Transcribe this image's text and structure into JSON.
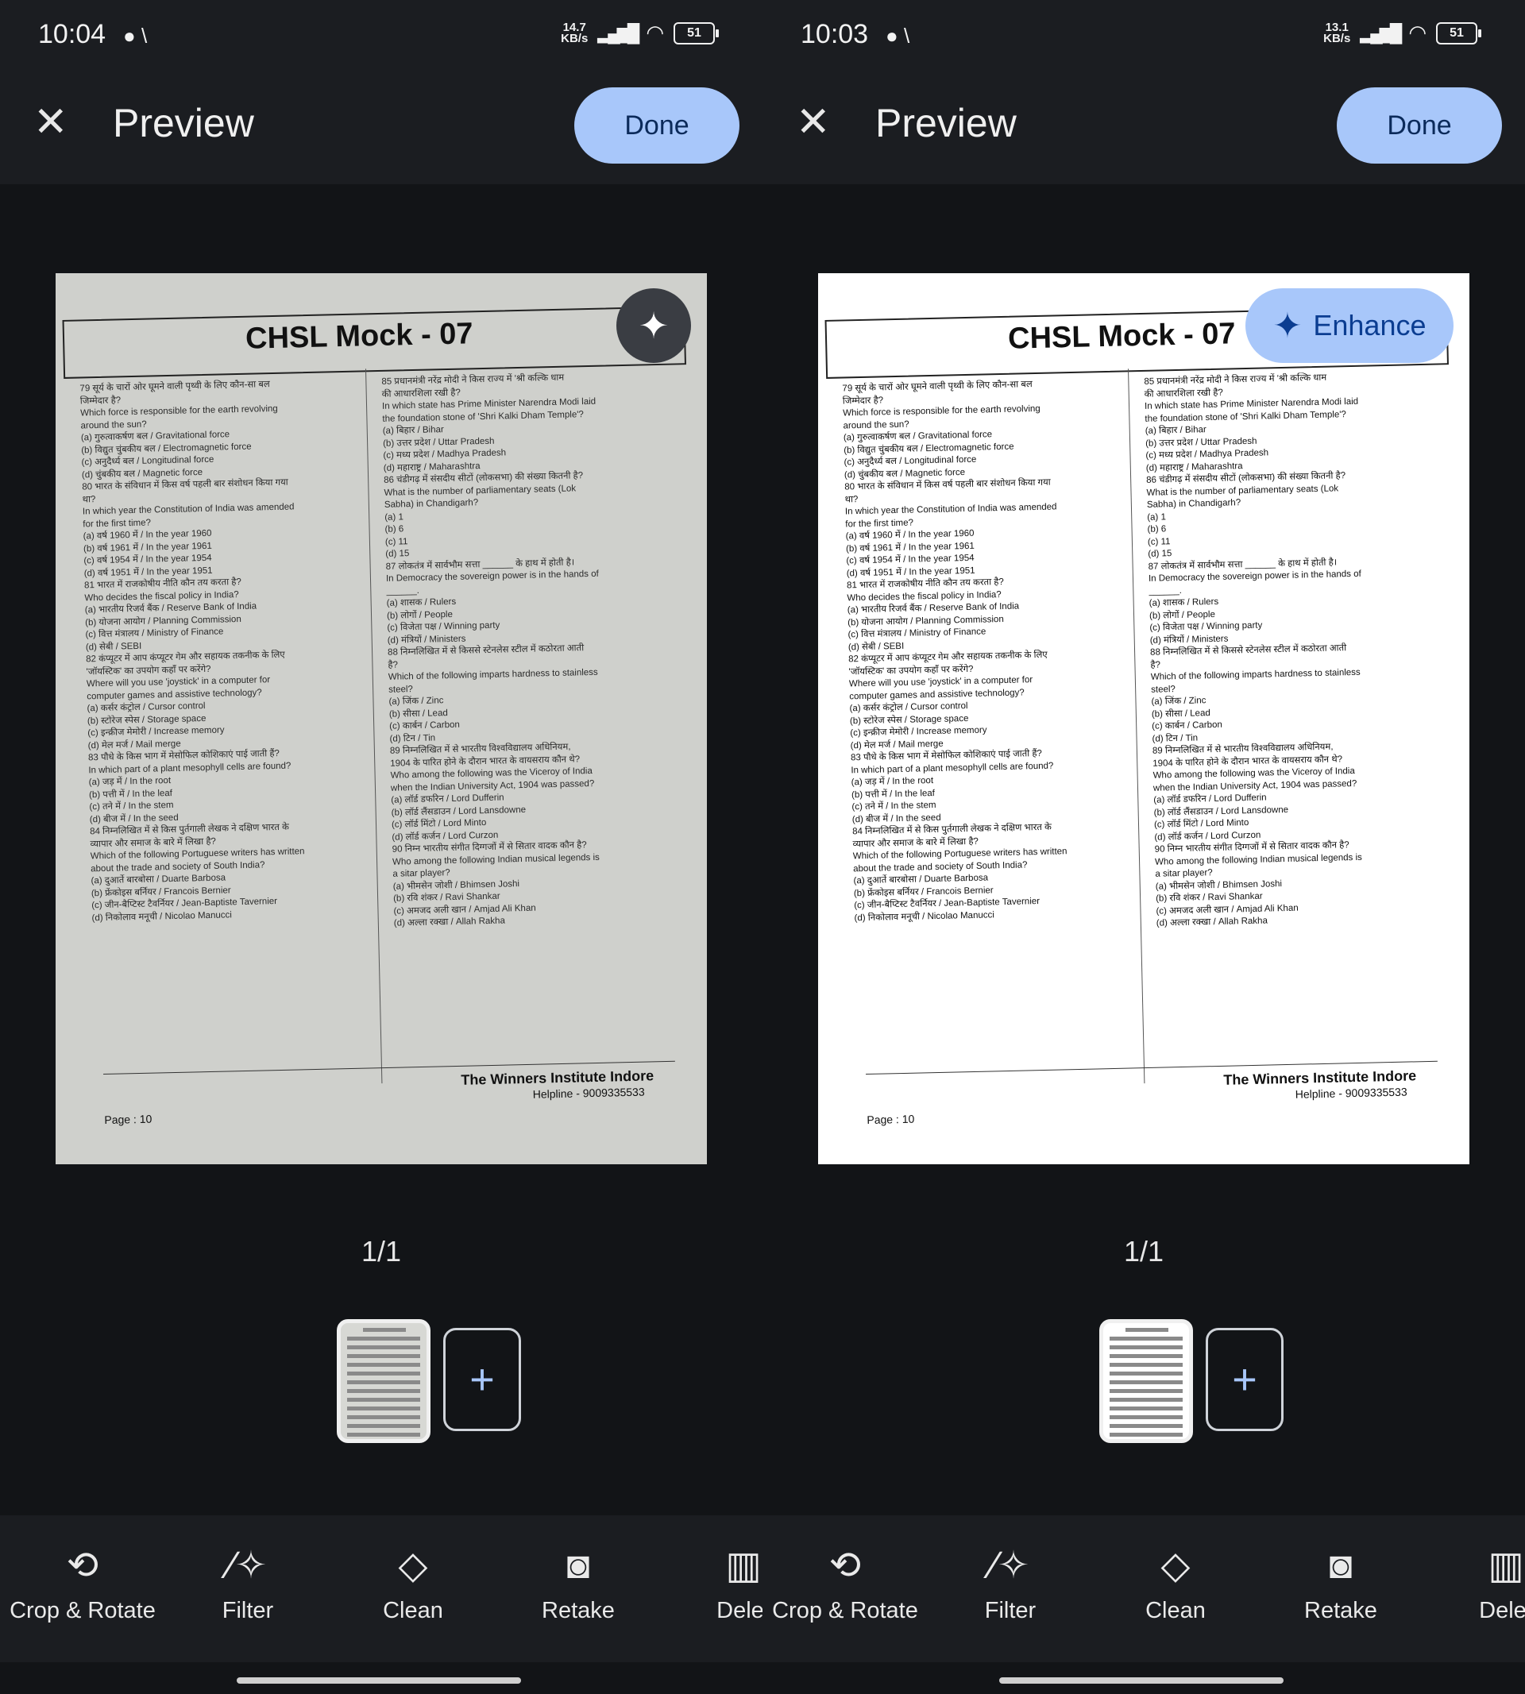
{
  "colors": {
    "accent": "#a8c7fa",
    "background": "#121417",
    "surface": "#1b1d21"
  },
  "screens": [
    {
      "status": {
        "time": "10:04",
        "speed_value": "14.7",
        "speed_unit": "KB/s",
        "battery": "51"
      },
      "appbar": {
        "close_icon": "close-icon",
        "title": "Preview",
        "done_label": "Done"
      },
      "enhance": {
        "icon": "sparkle-icon",
        "label": ""
      },
      "page_counter": "1/1",
      "add_page_label": "+",
      "tools": [
        {
          "icon": "crop-rotate-icon",
          "label": "Crop & Rotate"
        },
        {
          "icon": "filter-icon",
          "label": "Filter"
        },
        {
          "icon": "eraser-icon",
          "label": "Clean"
        },
        {
          "icon": "camera-icon",
          "label": "Retake"
        },
        {
          "icon": "trash-icon",
          "label": "Delet"
        }
      ]
    },
    {
      "status": {
        "time": "10:03",
        "speed_value": "13.1",
        "speed_unit": "KB/s",
        "battery": "51"
      },
      "appbar": {
        "close_icon": "close-icon",
        "title": "Preview",
        "done_label": "Done"
      },
      "enhance": {
        "icon": "sparkle-icon",
        "label": "Enhance"
      },
      "page_counter": "1/1",
      "add_page_label": "+",
      "tools": [
        {
          "icon": "crop-rotate-icon",
          "label": "Crop & Rotate"
        },
        {
          "icon": "filter-icon",
          "label": "Filter"
        },
        {
          "icon": "eraser-icon",
          "label": "Clean"
        },
        {
          "icon": "camera-icon",
          "label": "Retake"
        },
        {
          "icon": "trash-icon",
          "label": "Delet"
        }
      ]
    }
  ],
  "document": {
    "title": "CHSL Mock - 07",
    "left_column": [
      "79  सूर्य के चारों ओर घूमने वाली पृथ्वी के लिए कौन-सा बल",
      "     जिम्मेदार है?",
      "     Which force is responsible for the earth revolving",
      "     around the sun?",
      "     (a) गुरुत्वाकर्षण बल / Gravitational force",
      "     (b) विद्युत चुंबकीय बल / Electromagnetic force",
      "     (c) अनुदैर्ध्य बल / Longitudinal force",
      "     (d) चुंबकीय बल / Magnetic force",
      "80  भारत के संविधान में किस वर्ष पहली बार संशोधन किया गया",
      "     था?",
      "     In which year the Constitution of India was amended",
      "     for the first time?",
      "     (a) वर्ष 1960 में / In the year 1960",
      "     (b) वर्ष 1961 में / In the year 1961",
      "     (c) वर्ष 1954 में / In the year 1954",
      "     (d) वर्ष 1951 में / In the year 1951",
      "81  भारत में राजकोषीय नीति कौन तय करता है?",
      "     Who decides the fiscal policy in India?",
      "     (a) भारतीय रिजर्व बैंक / Reserve Bank of India",
      "     (b) योजना आयोग / Planning Commission",
      "     (c) वित्त मंत्रालय / Ministry of Finance",
      "     (d) सेबी / SEBI",
      "82  कंप्यूटर में आप कंप्यूटर गेम और सहायक तकनीक के लिए",
      "     'जॉयस्टिक' का उपयोग कहाँ पर करेंगे?",
      "     Where will you use 'joystick' in a computer for",
      "     computer games and assistive technology?",
      "     (a) कर्सर कंट्रोल / Cursor control",
      "     (b) स्टोरेज स्पेस / Storage space",
      "     (c) इन्क्रीज मेमोरी / Increase memory",
      "     (d) मेल मर्ज / Mail merge",
      "83  पौधे के किस भाग में मेसोफिल कोशिकाएं पाई जाती हैं?",
      "     In which part of a plant mesophyll cells are found?",
      "     (a) जड़ में / In the root",
      "     (b) पत्ती में / In the leaf",
      "     (c) तने में / In the stem",
      "     (d) बीज में / In the seed",
      "84  निम्नलिखित में से किस पुर्तगाली लेखक ने दक्षिण भारत के",
      "     व्यापार और समाज के बारे में लिखा है?",
      "     Which of the following Portuguese writers has written",
      "     about the trade and society of South India?",
      "     (a) दुआर्ते बारबोसा / Duarte Barbosa",
      "     (b) फ्रेंकोइस बर्नियर / Francois Bernier",
      "     (c) जीन-बैप्टिस्ट टैवर्नियर / Jean-Baptiste Tavernier",
      "     (d) निकोलाव मनूची / Nicolao Manucci"
    ],
    "right_column": [
      "85  प्रधानमंत्री नरेंद्र मोदी ने किस राज्य में 'श्री कल्कि धाम",
      "     की आधारशिला रखी है?",
      "     In which state has Prime Minister Narendra Modi laid",
      "     the foundation stone of 'Shri Kalki Dham Temple'?",
      "     (a) बिहार / Bihar",
      "     (b) उत्तर प्रदेश / Uttar Pradesh",
      "     (c) मध्य प्रदेश / Madhya Pradesh",
      "     (d) महाराष्ट्र / Maharashtra",
      "86  चंडीगढ़ में संसदीय सीटों (लोकसभा) की संख्या कितनी है?",
      "     What is the number of parliamentary seats (Lok",
      "     Sabha) in Chandigarh?",
      "     (a) 1",
      "     (b) 6",
      "     (c) 11",
      "     (d) 15",
      "87  लोकतंत्र में सार्वभौम सत्ता ______ के हाथ में होती है।",
      "     In Democracy the sovereign power is in the hands of",
      "     ______.",
      "     (a) शासक / Rulers",
      "     (b) लोगों / People",
      "     (c) विजेता पक्ष / Winning party",
      "     (d) मंत्रियों / Ministers",
      "88  निम्नलिखित में से किससे स्टेनलेस स्टील में कठोरता आती",
      "     है?",
      "     Which of the following imparts hardness to stainless",
      "     steel?",
      "     (a) जिंक / Zinc",
      "     (b) सीसा / Lead",
      "     (c) कार्बन / Carbon",
      "     (d) टिन / Tin",
      "89  निम्नलिखित में से भारतीय विश्वविद्यालय अधिनियम,",
      "     1904 के पारित होने के दौरान भारत के वायसराय कौन थे?",
      "     Who among the following was the Viceroy of India",
      "     when the Indian University Act, 1904 was passed?",
      "     (a) लॉर्ड डफरिन / Lord Dufferin",
      "     (b) लॉर्ड लैंसडाउन / Lord Lansdowne",
      "     (c) लॉर्ड मिंटो / Lord Minto",
      "     (d) लॉर्ड कर्जन / Lord Curzon",
      "90  निम्न भारतीय संगीत दिग्गजों में से सितार वादक कौन है?",
      "     Who among the following Indian musical legends is",
      "     a sitar player?",
      "     (a) भीमसेन जोशी / Bhimsen Joshi",
      "     (b) रवि शंकर / Ravi Shankar",
      "     (c) अमजद अली खान / Amjad Ali Khan",
      "     (d) अल्ला रक्खा / Allah Rakha"
    ],
    "footer_name": "The Winners Institute Indore",
    "footer_helpline": "Helpline - 9009335533",
    "footer_page": "Page : 10"
  }
}
